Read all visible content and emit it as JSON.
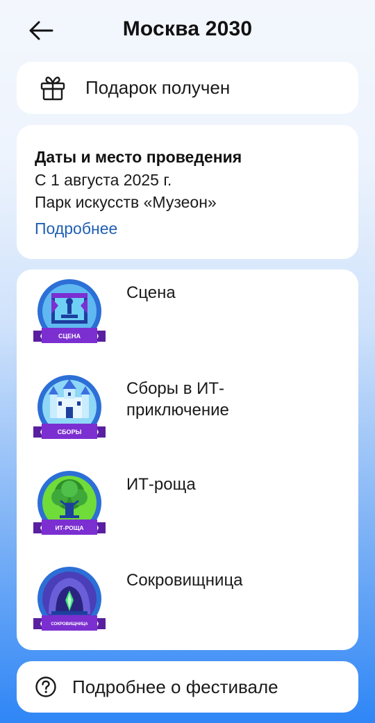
{
  "header": {
    "title": "Москва 2030",
    "back_icon": "arrow-left-icon"
  },
  "gift": {
    "icon": "gift-icon",
    "label": "Подарок получен"
  },
  "info": {
    "title": "Даты и место проведения",
    "date": "С 1 августа 2025 г.",
    "place": "Парк искусств «Музеон»",
    "more_link": "Подробнее",
    "link_color": "#1f5fb4"
  },
  "zones": [
    {
      "label": "Сцена",
      "badge_text": "СЦЕНА",
      "icon": "stage-badge-icon",
      "colors": {
        "ring": "#2c6fd6",
        "inner": "#5fb8f0",
        "ribbon": "#7b2fd1"
      }
    },
    {
      "label": "Сборы в ИТ-\nприключение",
      "badge_text": "СБОРЫ",
      "icon": "castle-badge-icon",
      "colors": {
        "ring": "#2c6fd6",
        "inner": "#8fd7f7",
        "ribbon": "#7b2fd1"
      }
    },
    {
      "label": "ИТ-роща",
      "badge_text": "ИТ-РОЩА",
      "icon": "tree-badge-icon",
      "colors": {
        "ring": "#2c6fd6",
        "inner": "#6fdc3a",
        "ribbon": "#7b2fd1"
      }
    },
    {
      "label": "Сокровищница",
      "badge_text": "СОКРОВИЩНИЦА",
      "icon": "cave-badge-icon",
      "colors": {
        "ring": "#2c6fd6",
        "inner": "#4a3fb8",
        "ribbon": "#7b2fd1"
      }
    }
  ],
  "about": {
    "icon": "question-circle-icon",
    "label": "Подробнее о фестивале"
  }
}
